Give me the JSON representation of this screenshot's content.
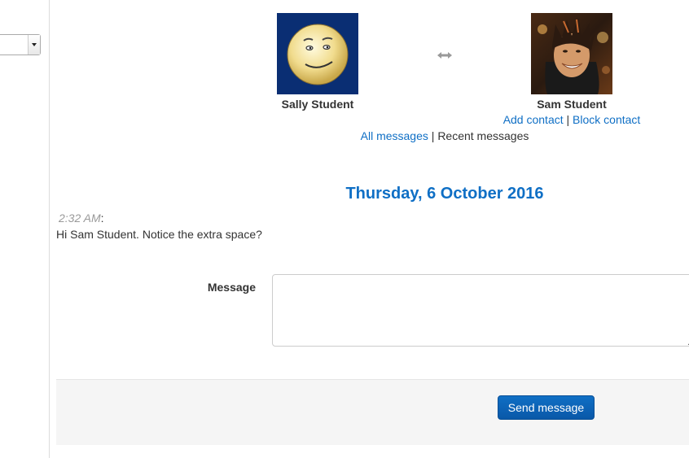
{
  "conversation": {
    "user_a": {
      "name": "Sally Student"
    },
    "user_b": {
      "name": "Sam Student",
      "add_contact": "Add contact",
      "block_contact": "Block contact",
      "separator": "|"
    },
    "view_links": {
      "all_messages": "All messages",
      "separator": "|",
      "recent_messages": "Recent messages"
    }
  },
  "messages": {
    "date_heading": "Thursday, 6 October 2016",
    "items": [
      {
        "time": "2:32 AM",
        "colon": ":",
        "text": "Hi Sam Student. Notice the extra space?"
      }
    ]
  },
  "form": {
    "message_label": "Message",
    "message_value": "",
    "send_label": "Send message"
  },
  "icons": {
    "swap": "swap-arrows-icon",
    "select_arrow": "chevron-down-icon"
  },
  "colors": {
    "link": "#0f6fc5",
    "heading": "#0f6fc5",
    "button": "#0f6fc5",
    "sally_avatar_bg": "#0a2e73",
    "muted": "#999999"
  }
}
